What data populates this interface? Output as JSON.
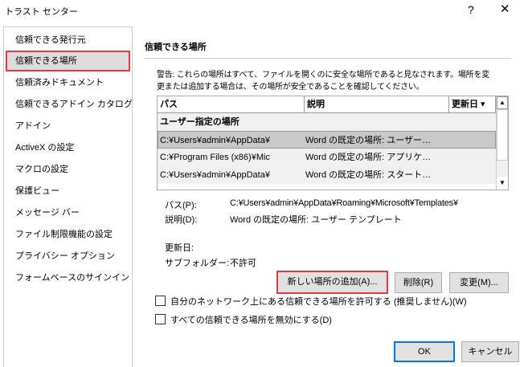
{
  "window": {
    "title": "トラスト センター",
    "help": "?",
    "close": "✕"
  },
  "sidebar": {
    "items": [
      {
        "label": "信頼できる発行元"
      },
      {
        "label": "信頼できる場所",
        "selected": true
      },
      {
        "label": "信頼済みドキュメント"
      },
      {
        "label": "信頼できるアドイン カタログ"
      },
      {
        "label": "アドイン"
      },
      {
        "label": "ActiveX の設定"
      },
      {
        "label": "マクロの設定"
      },
      {
        "label": "保護ビュー"
      },
      {
        "label": "メッセージ バー"
      },
      {
        "label": "ファイル制限機能の設定"
      },
      {
        "label": "プライバシー オプション"
      },
      {
        "label": "フォームベースのサインイン"
      }
    ]
  },
  "main": {
    "title": "信頼できる場所",
    "warning": [
      "警告: これらの場所はすべて、ファイルを開くのに安全な場所であると見なされます。場所を変",
      "更または追加する場合は、その場所が安全であることを確認してください。"
    ],
    "table": {
      "headers": [
        "パス",
        "説明",
        "更新日 ▾"
      ],
      "group": "ユーザー指定の場所",
      "rows": [
        {
          "path": "C:¥Users¥admin¥AppData¥",
          "desc": "Word の既定の場所: ユーザー…"
        },
        {
          "path": "C:¥Program Files (x86)¥Mic",
          "desc": "Word の既定の場所: アプリケ…"
        },
        {
          "path": "C:¥Users¥admin¥AppData¥",
          "desc": "Word の既定の場所: スタート…"
        }
      ]
    },
    "details": {
      "path_label": "パス(P):",
      "path_value": "C:¥Users¥admin¥AppData¥Roaming¥Microsoft¥Templates¥",
      "desc_label": "説明(D):",
      "desc_value": "Word の既定の場所: ユーザー テンプレート",
      "date_label": "更新日:",
      "sub_label": "サブフォルダー:",
      "sub_value": "不許可"
    },
    "buttons": {
      "add": "新しい場所の追加(A)...",
      "remove": "削除(R)",
      "modify": "変更(M)..."
    },
    "checkboxes": [
      {
        "label": "自分のネットワーク上にある信頼できる場所を許可する (推奨しません)(W)",
        "checked": false
      },
      {
        "label": "すべての信頼できる場所を無効にする(D)",
        "checked": false
      }
    ]
  },
  "footer": {
    "ok": "OK",
    "cancel": "キャンセル"
  }
}
